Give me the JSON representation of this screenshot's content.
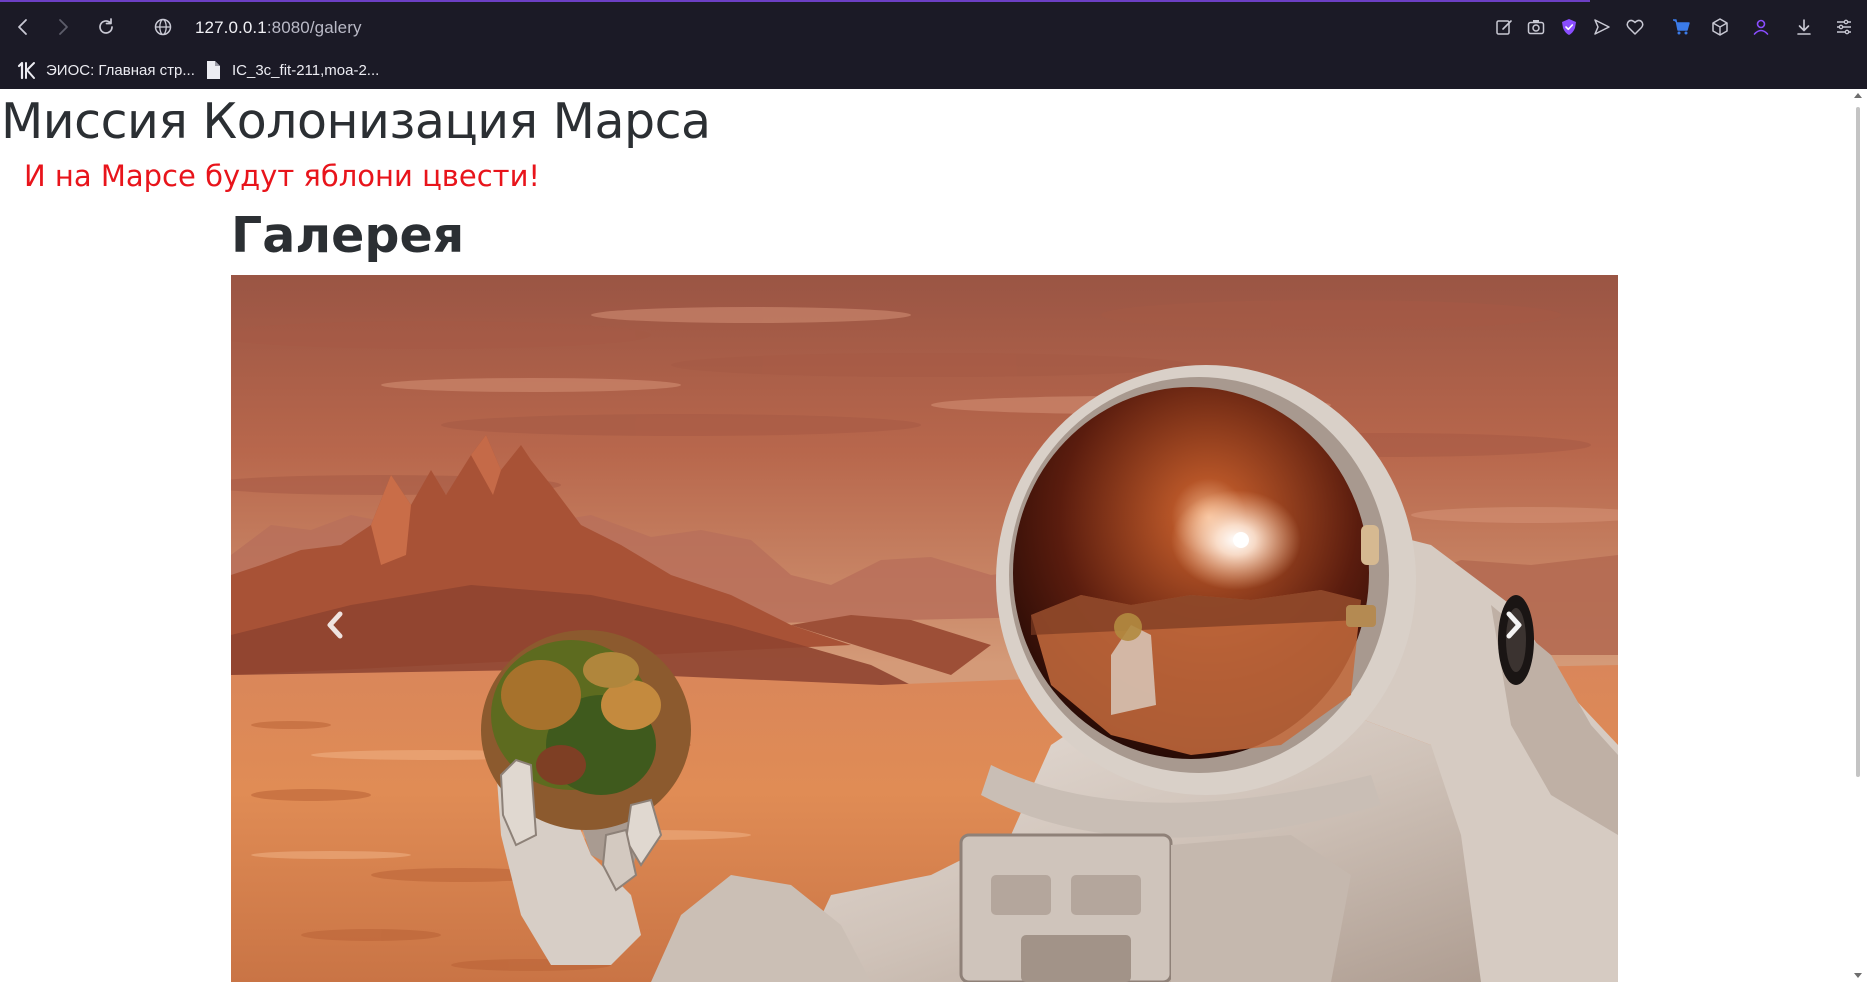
{
  "browser": {
    "url_host": "127.0.0.1",
    "url_path": ":8080/galery",
    "bookmarks": [
      {
        "label": "ЭИОС: Главная стр...",
        "icon": "eios-logo-icon"
      },
      {
        "label": "IC_3c_fit-211,moa-2...",
        "icon": "document-icon"
      }
    ],
    "toolbar_icons": [
      "edit-icon",
      "camera-icon",
      "shield-icon",
      "send-icon",
      "heart-icon",
      "cart-icon",
      "cube-icon",
      "profile-icon",
      "download-icon",
      "menu-icon"
    ],
    "accent_color": "#6c3fc4"
  },
  "page": {
    "title": "Миссия Колонизация Марса",
    "slogan": "И на Марсе будут яблони цвести!",
    "slogan_color": "#e8141b",
    "gallery_heading": "Галерея"
  },
  "carousel": {
    "image_subject": "astronaut-holding-rock-on-mars",
    "prev_icon": "chevron-left-icon",
    "next_icon": "chevron-right-icon"
  }
}
